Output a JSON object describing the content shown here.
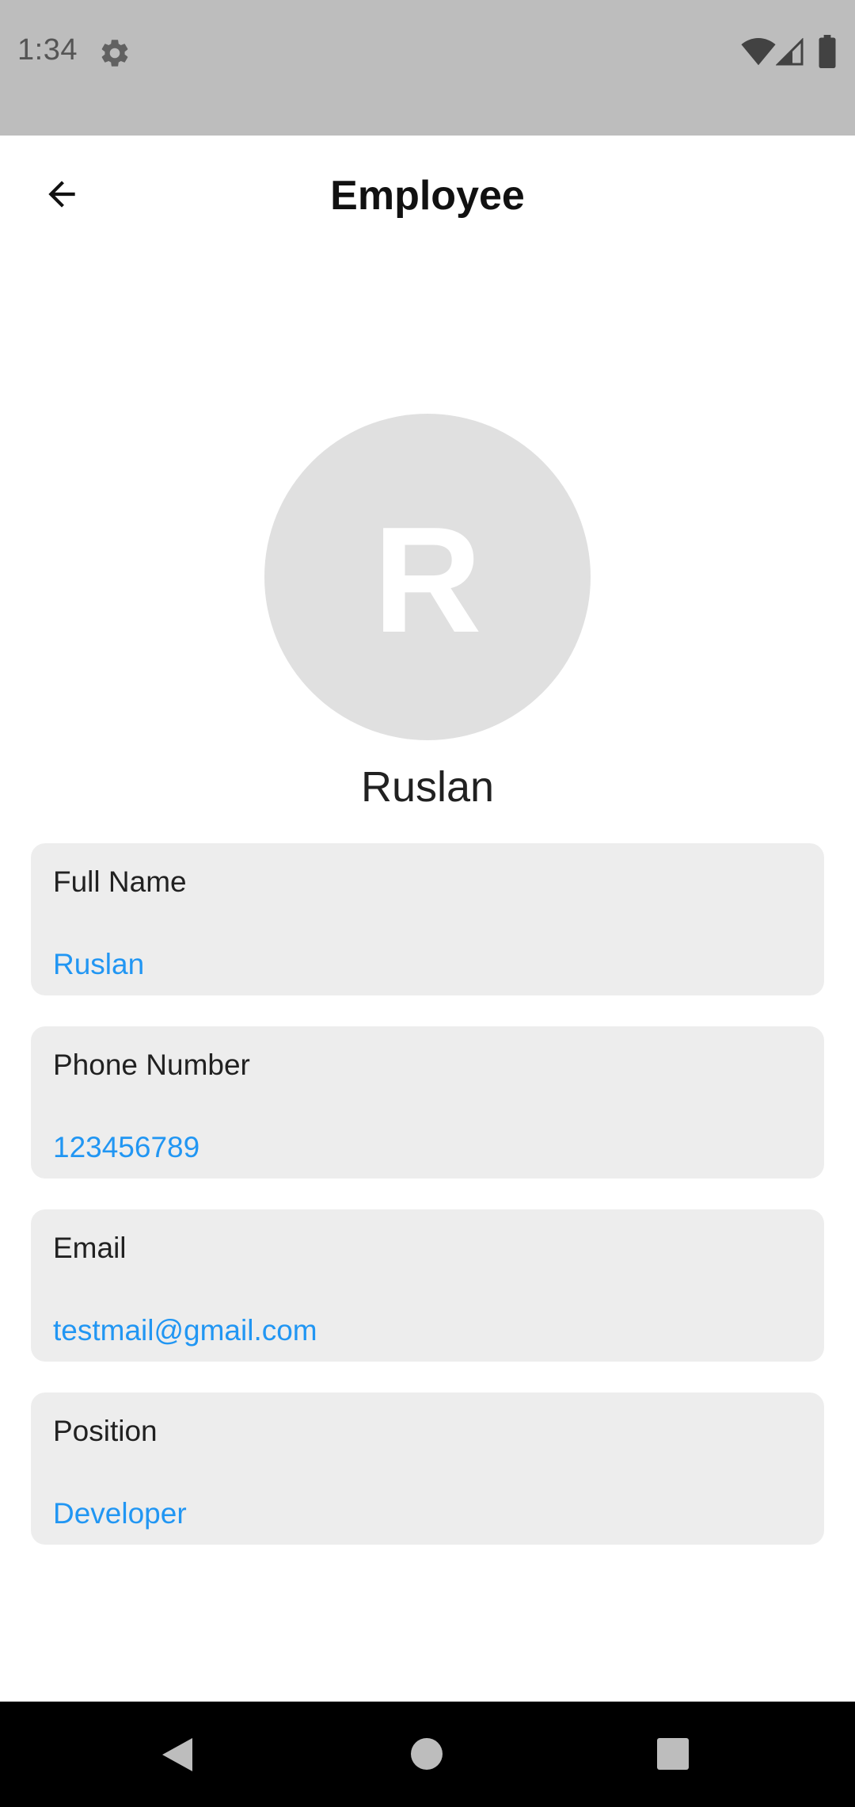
{
  "status_bar": {
    "time": "1:34",
    "icons": [
      "gear-icon",
      "wifi-icon",
      "signal-icon",
      "battery-icon"
    ]
  },
  "app_bar": {
    "title": "Employee",
    "back_icon": "arrow-left-icon"
  },
  "profile": {
    "initial": "R",
    "name": "Ruslan"
  },
  "fields": [
    {
      "label": "Full Name",
      "value": "Ruslan"
    },
    {
      "label": "Phone Number",
      "value": "123456789"
    },
    {
      "label": "Email",
      "value": "testmail@gmail.com"
    },
    {
      "label": "Position",
      "value": "Developer"
    }
  ],
  "nav_bar": {
    "buttons": [
      "back-triangle-icon",
      "home-circle-icon",
      "recents-square-icon"
    ]
  },
  "colors": {
    "status_bar_bg": "#bdbdbd",
    "card_bg": "#ededed",
    "value_blue": "#2196f3",
    "avatar_bg": "#e0e0e0"
  }
}
